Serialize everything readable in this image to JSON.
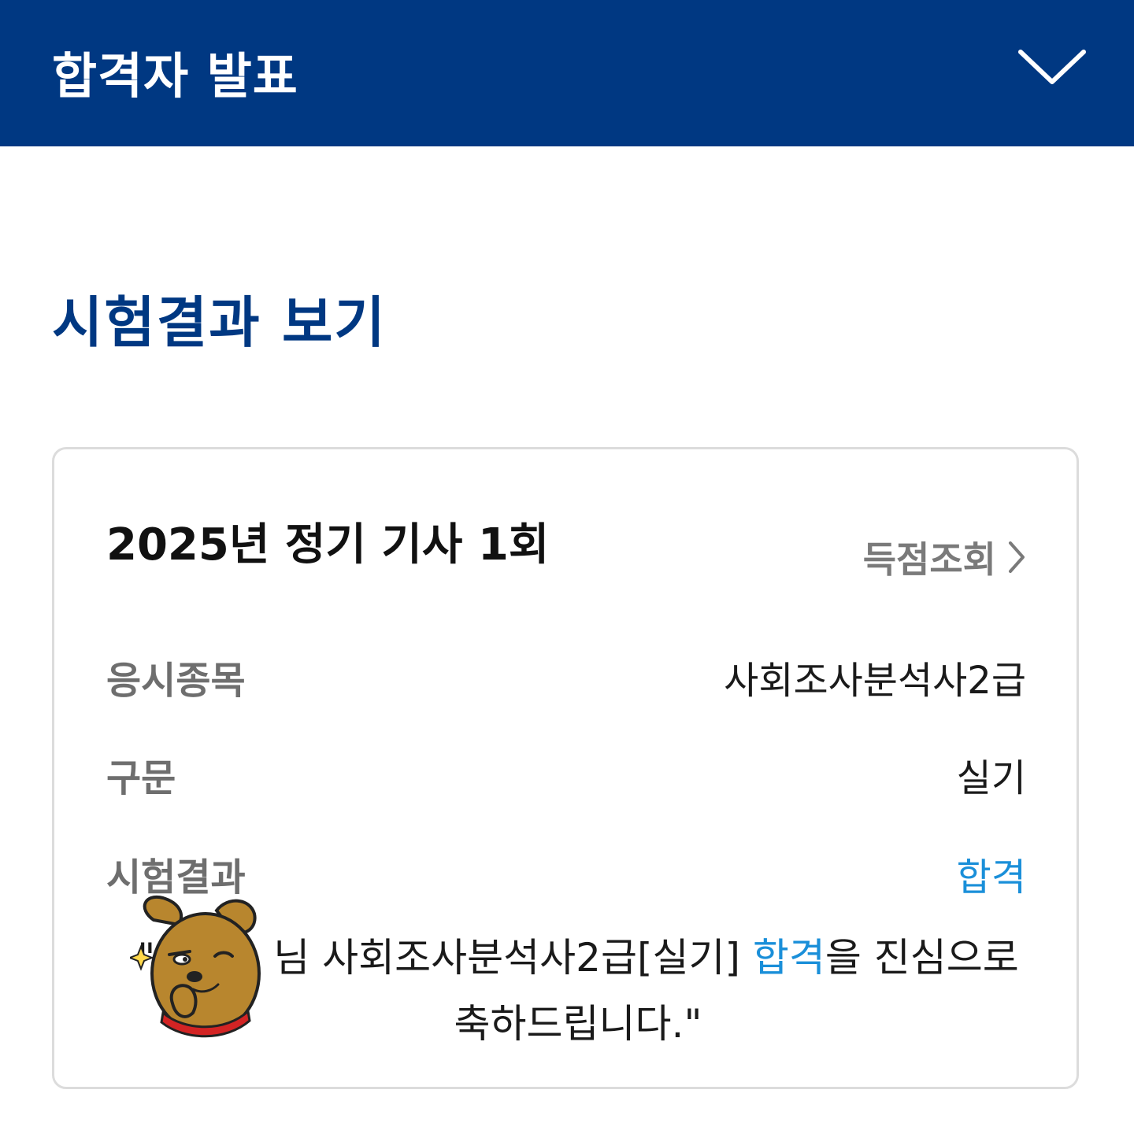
{
  "header": {
    "title": "합격자 발표",
    "toggle_icon": "chevron-down-icon"
  },
  "section": {
    "title": "시험결과 보기"
  },
  "card": {
    "exam_title": "2025년 정기 기사 1회",
    "score_link": {
      "label": "득점조회",
      "icon": "chevron-right-icon"
    },
    "rows": [
      {
        "label": "응시종목",
        "value": "사회조사분석사2급"
      },
      {
        "label": "구문",
        "value": "실기"
      },
      {
        "label": "시험결과",
        "value": "합격"
      }
    ],
    "congrats": {
      "quote_open": "\"",
      "after_name": "님 사회조사분석사2급[실기] ",
      "highlight": "합격",
      "rest": "을 진심으로 축하드립니다.\""
    },
    "sticker": "thinking-dog-sticker"
  },
  "colors": {
    "header_bg": "#003882",
    "title": "#003882",
    "pass": "#1a8fd9",
    "label": "#6e6e6e"
  }
}
